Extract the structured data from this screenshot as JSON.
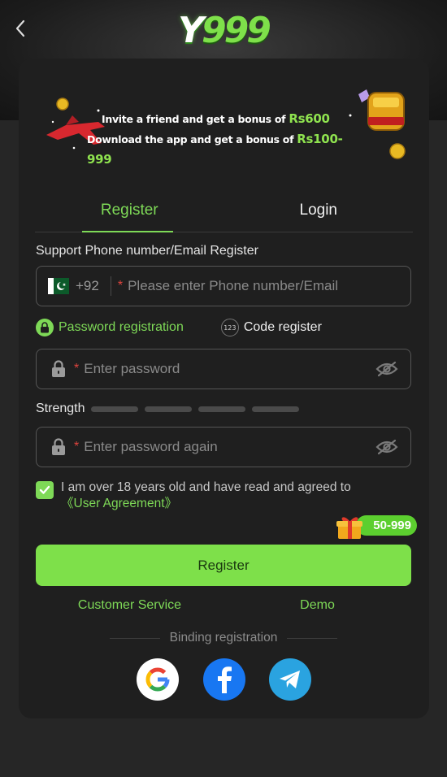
{
  "logo": {
    "prefix": "Y",
    "number": "999"
  },
  "banner": {
    "line1_text": "Invite a friend and get a bonus of",
    "line1_amount": "Rs600",
    "line2_text": "Download the app and get a bonus of",
    "line2_amount": "Rs100-999"
  },
  "tabs": {
    "register": "Register",
    "login": "Login"
  },
  "form": {
    "section_label": "Support Phone number/Email Register",
    "country_code": "+92",
    "required_mark": "*",
    "phone_placeholder": "Please enter Phone number/Email",
    "mode_password": "Password registration",
    "mode_code": "Code register",
    "mode_code_icon_text": "123",
    "password_placeholder": "Enter password",
    "strength_label": "Strength",
    "password_again_placeholder": "Enter password again",
    "agreement_text": "I am over 18 years old and have read and agreed to",
    "agreement_link": "《User Agreement》",
    "agreement_checked": true
  },
  "gift_badge": "50-999",
  "register_button": "Register",
  "links": {
    "customer_service": "Customer Service",
    "demo": "Demo"
  },
  "binding_label": "Binding registration",
  "social": [
    "google-icon",
    "facebook-icon",
    "telegram-icon"
  ],
  "colors": {
    "accent": "#7ed957",
    "button": "#7ee04a",
    "required": "#e0443e",
    "background": "#262626",
    "card": "#1f1f1f"
  }
}
